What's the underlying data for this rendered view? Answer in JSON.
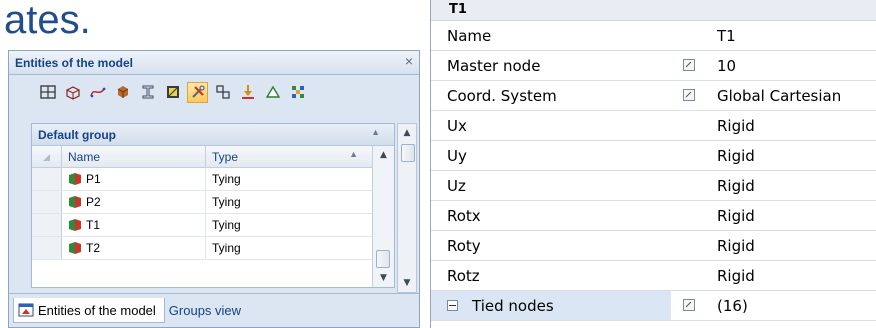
{
  "heading_fragment": "ates.",
  "left_panel": {
    "title": "Entities of the model",
    "close_label": "×",
    "toolbar_icons": [
      "grid-icon",
      "solid-box-icon",
      "curve-icon",
      "cube-icon",
      "beam-icon",
      "material-icon",
      "tools-icon",
      "tying-icon",
      "load-icon",
      "support-icon",
      "mesh-icon"
    ],
    "active_tool": "tools-icon",
    "group": {
      "title": "Default group",
      "columns": {
        "name": "Name",
        "type": "Type"
      },
      "rows": [
        {
          "name": "P1",
          "type": "Tying"
        },
        {
          "name": "P2",
          "type": "Tying"
        },
        {
          "name": "T1",
          "type": "Tying"
        },
        {
          "name": "T2",
          "type": "Tying"
        }
      ]
    },
    "tabs": [
      {
        "label": "Entities of the model",
        "active": true
      },
      {
        "label": "Groups view",
        "active": false
      }
    ]
  },
  "properties": {
    "title": "T1",
    "rows": [
      {
        "name": "Name",
        "value": "T1",
        "has_button": false
      },
      {
        "name": "Master node",
        "value": "10",
        "has_button": true
      },
      {
        "name": "Coord. System",
        "value": "Global Cartesian",
        "has_button": true
      },
      {
        "name": "Ux",
        "value": "Rigid",
        "has_button": false
      },
      {
        "name": "Uy",
        "value": "Rigid",
        "has_button": false
      },
      {
        "name": "Uz",
        "value": "Rigid",
        "has_button": false
      },
      {
        "name": "Rotx",
        "value": "Rigid",
        "has_button": false
      },
      {
        "name": "Roty",
        "value": "Rigid",
        "has_button": false
      },
      {
        "name": "Rotz",
        "value": "Rigid",
        "has_button": false
      }
    ],
    "tied": {
      "name": "Tied nodes",
      "value": "(16)"
    }
  },
  "colors": {
    "heading": "#1f4e8c",
    "panel_bg": "#dce6f2",
    "header_text": "#15428b",
    "tied_highlight": "#dbe6f4"
  }
}
